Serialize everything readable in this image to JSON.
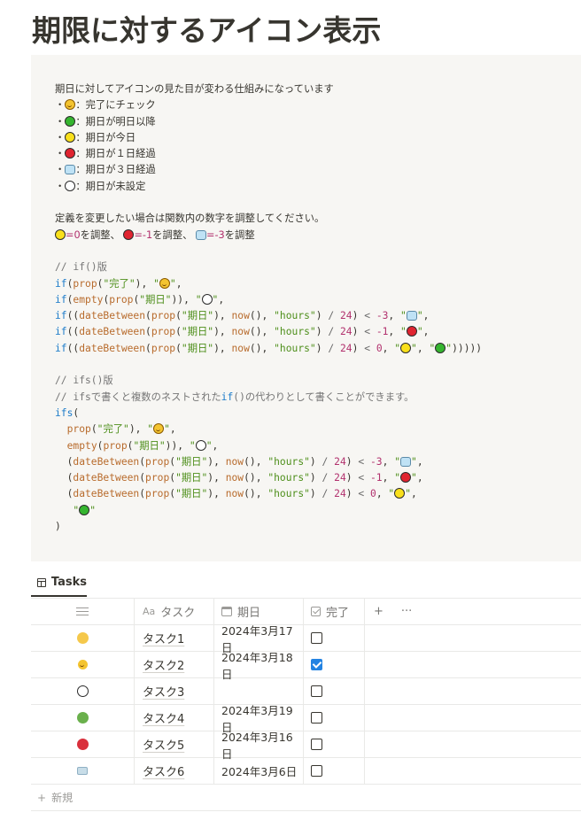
{
  "page": {
    "title": "期限に対するアイコン表示"
  },
  "code": {
    "intro": "期日に対してアイコンの見た目が変わる仕組みになっています",
    "legend": [
      {
        "icon": "smile-icon",
        "text": "：完了にチェック"
      },
      {
        "icon": "green-circle-icon",
        "text": "：期日が明日以降"
      },
      {
        "icon": "yellow-circle-icon",
        "text": "：期日が今日"
      },
      {
        "icon": "red-circle-icon",
        "text": "：期日が１日経過"
      },
      {
        "icon": "ice-cube-icon",
        "text": "：期日が３日経過"
      },
      {
        "icon": "white-circle-icon",
        "text": "：期日が未設定"
      }
    ],
    "adjust_note": "定義を変更したい場合は関数内の数字を調整してください。",
    "adjust": {
      "yellow_value": "=0",
      "yellow_suffix": "を調整、",
      "red_value": "=-1",
      "red_suffix": "を調整、",
      "ice_value": "=-3",
      "ice_suffix": "を調整"
    },
    "comment_if": "// if()版",
    "comment_ifs_1": "// ifs()版",
    "comment_ifs_2_prefix": "// ifsで書くと複数のネストされた",
    "comment_ifs_2_kw": "if",
    "comment_ifs_2_suffix": "()の代わりとして書くことができます。",
    "tokens": {
      "if": "if",
      "ifs": "ifs",
      "prop": "prop",
      "empty": "empty",
      "dateBetween": "dateBetween",
      "now": "now",
      "prop_done": "\"完了\"",
      "prop_date": "\"期日\"",
      "hours": "\"hours\"",
      "n24": "24",
      "n3": "-3",
      "n1": "-1",
      "n0": "0"
    }
  },
  "tabs": [
    {
      "label": "Tasks"
    }
  ],
  "table": {
    "columns": [
      {
        "label": "",
        "icon": "filter-icon"
      },
      {
        "label": "タスク",
        "icon": "Aa"
      },
      {
        "label": "期日",
        "icon": "calendar-icon"
      },
      {
        "label": "完了",
        "icon": "checkbox-icon"
      }
    ],
    "add_icon": "+",
    "more_icon": "···",
    "rows": [
      {
        "status": "yellow-circle",
        "task": "タスク1",
        "date": "2024年3月17日",
        "done": false
      },
      {
        "status": "smile",
        "task": "タスク2",
        "date": "2024年3月18日",
        "done": true
      },
      {
        "status": "white-circle",
        "task": "タスク3",
        "date": "",
        "done": false
      },
      {
        "status": "green-circle",
        "task": "タスク4",
        "date": "2024年3月19日",
        "done": false
      },
      {
        "status": "red-circle",
        "task": "タスク5",
        "date": "2024年3月16日",
        "done": false
      },
      {
        "status": "ice-cube",
        "task": "タスク6",
        "date": "2024年3月6日",
        "done": false
      }
    ],
    "new_label": "新規",
    "colors": {
      "yellow": "#f5c84b",
      "green": "#6ab04c",
      "red": "#d9303c",
      "checked": "#2383e2"
    }
  }
}
